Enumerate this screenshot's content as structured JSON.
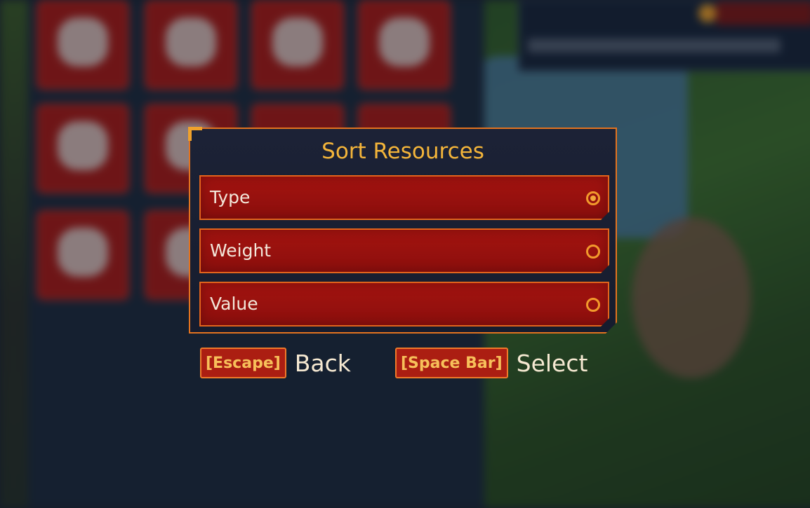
{
  "dialog": {
    "title": "Sort Resources",
    "options": [
      {
        "label": "Type",
        "selected": true
      },
      {
        "label": "Weight",
        "selected": false
      },
      {
        "label": "Value",
        "selected": false
      }
    ]
  },
  "hints": {
    "back_key": "[Escape]",
    "back_label": "Back",
    "select_key": "[Space Bar]",
    "select_label": "Select"
  },
  "colors": {
    "accent": "#e3731f",
    "title": "#f4b53a",
    "option_bg": "#a3130f",
    "panel_bg": "#1c2236"
  }
}
